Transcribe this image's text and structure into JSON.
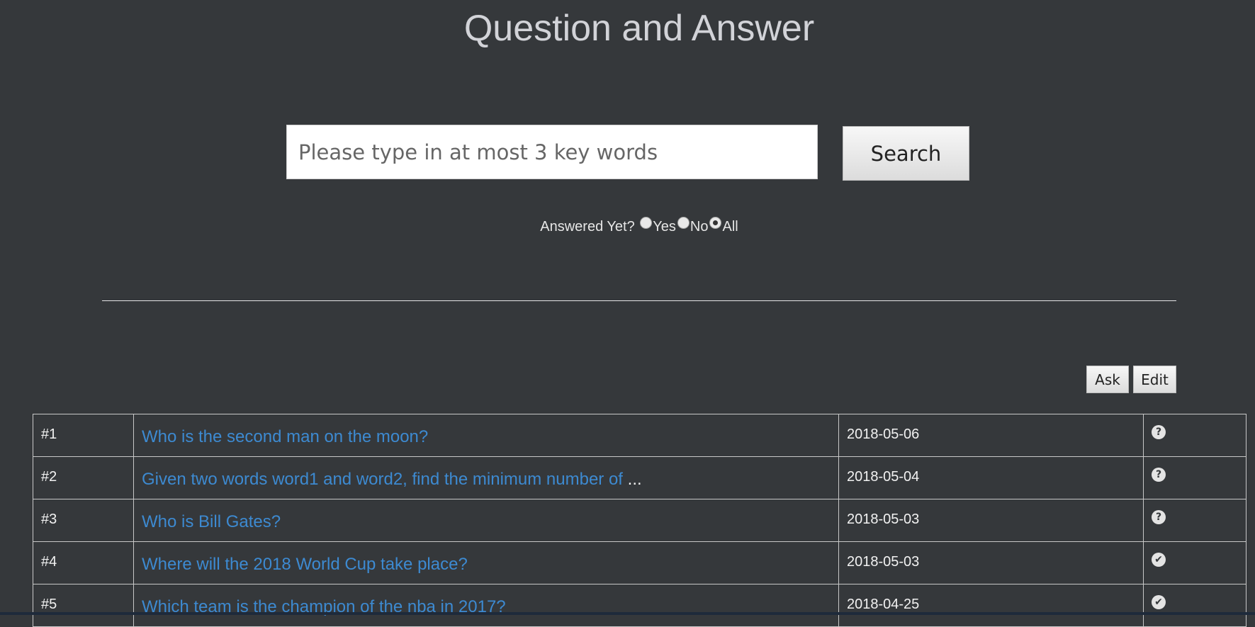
{
  "page": {
    "title": "Question and Answer"
  },
  "search": {
    "placeholder": "Please type in at most 3 key words",
    "value": "",
    "button_label": "Search"
  },
  "filter": {
    "label": "Answered Yet?",
    "options": [
      "Yes",
      "No",
      "All"
    ],
    "selected": "All"
  },
  "actions": {
    "ask_label": "Ask",
    "edit_label": "Edit"
  },
  "questions": [
    {
      "num": "#1",
      "text": "Who is the second man on the moon?",
      "ellipsis": "",
      "date": "2018-05-06",
      "status": "question-circle-icon",
      "glyph": "?"
    },
    {
      "num": "#2",
      "text": "Given two words word1 and word2, find the minimum number of",
      "ellipsis": "...",
      "date": "2018-05-04",
      "status": "question-circle-icon",
      "glyph": "?"
    },
    {
      "num": "#3",
      "text": "Who is Bill Gates?",
      "ellipsis": "",
      "date": "2018-05-03",
      "status": "question-circle-icon",
      "glyph": "?"
    },
    {
      "num": "#4",
      "text": "Where will the 2018 World Cup take place?",
      "ellipsis": "",
      "date": "2018-05-03",
      "status": "check-circle-icon",
      "glyph": "✔"
    },
    {
      "num": "#5",
      "text": "Which team is the champion of the nba in 2017?",
      "ellipsis": "",
      "date": "2018-04-25",
      "status": "check-circle-icon",
      "glyph": "✔"
    }
  ],
  "colors": {
    "background": "#35383b",
    "link": "#3d8ad1",
    "title": "#d2d3d8"
  }
}
